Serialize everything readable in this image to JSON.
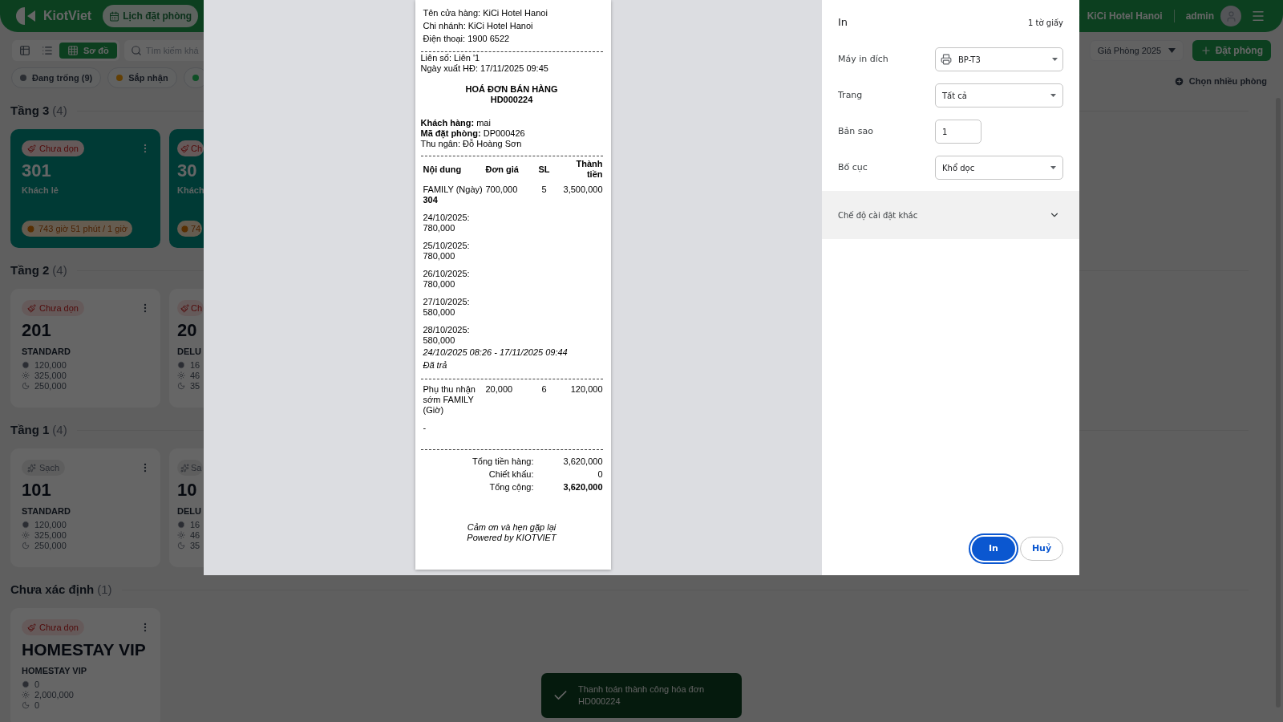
{
  "app": {
    "brand": "KiotViet",
    "calendar_button": "Lịch đặt phòng",
    "location": "KiCi Hotel Hanoi",
    "user": "admin",
    "views": [
      {
        "kind": "table",
        "selected": false
      },
      {
        "kind": "list",
        "selected": false
      },
      {
        "kind": "grid",
        "label": "Sơ đồ",
        "selected": true
      }
    ],
    "search": {
      "placeholder": "Tìm kiếm khá"
    },
    "price_list": "Giá Phòng 2025",
    "book_button": "Đặt phòng",
    "multi_select": "Chọn nhiều phòng",
    "filters": [
      {
        "label": "Đang trống (9)",
        "color": "#2b2e33"
      },
      {
        "label": "Sắp nhận",
        "color": "#623f04"
      },
      {
        "color": "#0e4f26"
      }
    ],
    "floors": [
      {
        "name": "Tầng 3",
        "count": "(4)",
        "rooms": [
          {
            "kind": "occupied",
            "status": {
              "kind": "dirty",
              "label": "Chưa dọn"
            },
            "number": "301",
            "guest": "Khách lẻ",
            "timer": "743 giờ 51 phút / 1 giờ"
          },
          {
            "kind": "occupied",
            "status": {
              "kind": "dirty",
              "label": "Ch"
            },
            "number": "30",
            "guest": "Khách",
            "timer": "74"
          }
        ]
      },
      {
        "name": "Tầng 2",
        "count": "(4)",
        "rooms": [
          {
            "kind": "vacant",
            "status": {
              "kind": "dirty",
              "label": "Chưa dọn"
            },
            "number": "201",
            "type": "STANDARD",
            "prices": [
              "120,000",
              "325,000",
              "250,000"
            ]
          },
          {
            "kind": "vacant",
            "status": {
              "kind": "dirty",
              "label": "Ch"
            },
            "number": "20",
            "type": "DELU",
            "prices": [
              "16",
              "46",
              "35"
            ]
          }
        ]
      },
      {
        "name": "Tầng 1",
        "count": "(4)",
        "rooms": [
          {
            "kind": "vacant",
            "status": {
              "kind": "clean",
              "label": "Sạch"
            },
            "number": "101",
            "type": "STANDARD",
            "prices": [
              "120,000",
              "325,000",
              "250,000"
            ]
          },
          {
            "kind": "vacant",
            "status": {
              "kind": "clean",
              "label": "Sa"
            },
            "number": "10",
            "type": "DELU",
            "prices": [
              "16",
              "46",
              "35"
            ]
          }
        ]
      },
      {
        "name": "Chưa xác định",
        "count": "(1)",
        "rooms": [
          {
            "kind": "vacant",
            "status": {
              "kind": "dirty",
              "label": "Chưa dọn"
            },
            "number": "HOMESTAY VIP",
            "type": "HOMESTAY VIP",
            "prices": [
              "0",
              "2,000,000",
              "0"
            ]
          }
        ]
      }
    ]
  },
  "toast": {
    "message": "Thanh toán thành công hóa đơn HD000224"
  },
  "receipt": {
    "store_lines": [
      "Tên cửa hàng: KiCi Hotel Hanoi",
      "Chi nhánh: KiCi Hotel Hanoi",
      "Điện thoại: 1900 6522"
    ],
    "meta_lines": [
      "Liên số: Liên '1",
      "Ngày xuất HĐ: 17/11/2025 09:45"
    ],
    "title": "HOÁ ĐƠN BÁN HÀNG",
    "code": "HD000224",
    "info_lines": [
      "**Khách hàng:** mai",
      "**Mã đặt phòng:** DP000426",
      "Thu ngân: Đỗ Hoàng Sơn"
    ],
    "columns": [
      "Nội dung",
      "Đơn giá",
      "SL",
      "Thành tiền"
    ],
    "items": [
      {
        "name": "FAMILY (Ngày)",
        "room": "304",
        "price": "700,000",
        "qty": "5",
        "amount": "3,500,000",
        "notes": [
          "24/10/2025: 780,000",
          "25/10/2025: 780,000",
          "26/10/2025: 780,000",
          "27/10/2025: 580,000",
          "28/10/2025: 580,000"
        ],
        "period": "24/10/2025 08:26 - 17/11/2025 09:44",
        "status": "Đã trả"
      },
      {
        "name": "Phụ thu nhận sớm FAMILY (Giờ)",
        "price": "20,000",
        "qty": "6",
        "amount": "120,000",
        "notes": [
          "-"
        ]
      }
    ],
    "totals": [
      {
        "label": "Tổng tiền hàng:",
        "value": "3,620,000",
        "bold": false
      },
      {
        "label": "Chiết khấu:",
        "value": "0",
        "bold": false
      },
      {
        "label": "Tổng cộng:",
        "value": "3,620,000",
        "bold": true
      }
    ],
    "footer_lines": [
      "Cảm ơn và hẹn gặp lại",
      "Powered by KIOTVIET"
    ]
  },
  "print_dialog": {
    "title": "In",
    "sheets": "1 tờ giấy",
    "fields": [
      {
        "kind": "printer",
        "label": "Máy in đích",
        "value": "BP-T3"
      },
      {
        "kind": "select",
        "label": "Trang",
        "value": "Tất cả"
      },
      {
        "kind": "number",
        "label": "Bản sao",
        "value": "1"
      },
      {
        "kind": "select",
        "label": "Bố cục",
        "value": "Khổ dọc"
      }
    ],
    "more_settings": {
      "label": "Chế độ cài đặt khác",
      "expanded": false
    },
    "buttons": [
      {
        "label": "In",
        "primary": true
      },
      {
        "label": "Huỷ",
        "primary": false
      }
    ]
  }
}
